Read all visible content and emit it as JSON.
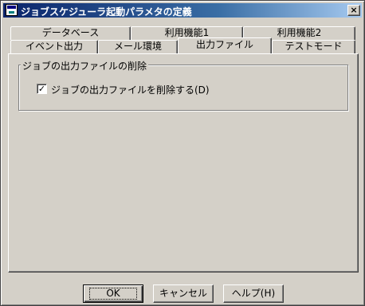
{
  "window": {
    "title": "ジョブスケジューラ起動パラメタの定義",
    "close_glyph": "×"
  },
  "tabs": {
    "row_back": [
      {
        "label": "データベース"
      },
      {
        "label": "利用機能1"
      },
      {
        "label": "利用機能2"
      }
    ],
    "row_front": [
      {
        "label": "イベント出力"
      },
      {
        "label": "メール環境"
      },
      {
        "label": "出力ファイル",
        "active": true
      },
      {
        "label": "テストモード"
      }
    ]
  },
  "group": {
    "title": "ジョブの出力ファイルの削除",
    "checkbox_label": "ジョブの出力ファイルを削除する(D)",
    "checkbox_checked": true,
    "check_glyph": "✓"
  },
  "buttons": {
    "ok": "OK",
    "cancel": "キャンセル",
    "help": "ヘルプ(H)"
  }
}
